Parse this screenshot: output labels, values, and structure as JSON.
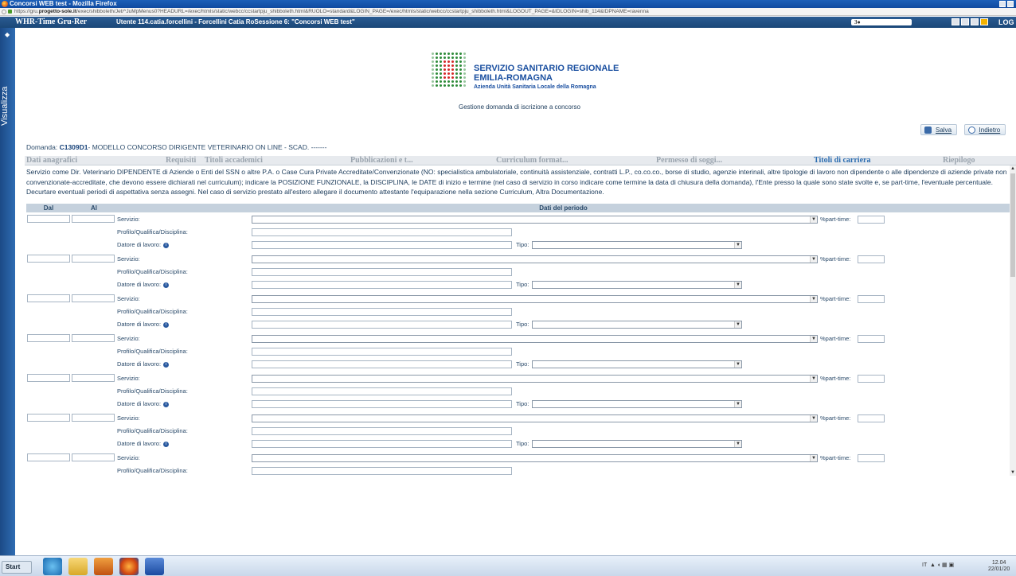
{
  "window": {
    "title": "Concorsi WEB test - Mozilla Firefox",
    "url_prefix": "https://gru.",
    "url_domain": "progetto-sole.it",
    "url_rest": "/exec/shibboleth/Jet/^JuMpMenus0?HEADURL=/exec/htmls/static/webcc/ccstartpju_shibboleth.html&RUOLO=standard&LOGIN_PAGE=/exec/htmls/static/webcc/ccstartpju_shibboleth.html&LOGOUT_PAGE=&IDLOGIN=shib_114&IDPNAME=ravenna"
  },
  "appbar": {
    "app_name": "WHR-Time Gru-Rer",
    "user_info": "Utente 114.catia.forcellini - Forcellini Catia RoSessione 6: \"Concorsi WEB test\"",
    "search_value": "3●",
    "logout": "LOG O"
  },
  "sidebar": {
    "label": "Visualizza"
  },
  "logo": {
    "line1": "SERVIZIO SANITARIO REGIONALE",
    "line2": "EMILIA-ROMAGNA",
    "line3": "Azienda Unità Sanitaria Locale della Romagna"
  },
  "subtitle": "Gestione domanda di iscrizione a concorso",
  "actions": {
    "save": "Salva",
    "back": "Indietro"
  },
  "domanda": {
    "label": "Domanda: ",
    "code": "C1309D1",
    "text": "- MODELLO CONCORSO DIRIGENTE VETERINARIO ON LINE - SCAD. -------"
  },
  "tabs": [
    {
      "label": "Dati anagrafici",
      "active": false
    },
    {
      "label": "Requisiti",
      "active": false
    },
    {
      "label": "Titoli accademici",
      "active": false
    },
    {
      "label": "Pubblicazioni e t...",
      "active": false
    },
    {
      "label": "Curriculum format...",
      "active": false
    },
    {
      "label": "Permesso di soggi...",
      "active": false
    },
    {
      "label": "Titoli di carriera",
      "active": true
    },
    {
      "label": "Riepilogo",
      "active": false
    }
  ],
  "description": "Servizio come Dir. Veterinario DIPENDENTE di Aziende o Enti del SSN o altre P.A. o Case Cura Private Accreditate/Convenzionate (NO: specialistica ambulatoriale, continuità assistenziale, contratti L.P., co.co.co., borse di studio, agenzie interinali, altre tipologie di lavoro non dipendente o alle dipendenze di aziende private non convenzionate-accreditate, che devono essere dichiarati nel curriculum); indicare la POSIZIONE FUNZIONALE, la DISCIPLINA, le DATE di inizio e termine (nel caso di servizio in corso indicare come termine la data di chiusura della domanda), l'Ente presso la quale sono state svolte e, se part-time, l'eventuale percentuale. Decurtare eventuali periodi di aspettativa senza assegni. Nel caso di servizio prestato all'estero allegare il documento attestante l'equiparazione nella sezione Curriculum, Altra Documentazione.",
  "table": {
    "col_dal": "Dal",
    "col_al": "Al",
    "col_dati": "Dati del periodo",
    "label_servizio": "Servizio:",
    "label_parttime": "%part-time:",
    "label_profilo": "Profilo/Qualifica/Disciplina:",
    "label_datore": "Datore di lavoro:",
    "label_tipo": "Tipo:",
    "period_count": 7
  },
  "taskbar": {
    "start": "Start",
    "lang": "IT",
    "time": "12.04",
    "date": "22/01/20"
  }
}
